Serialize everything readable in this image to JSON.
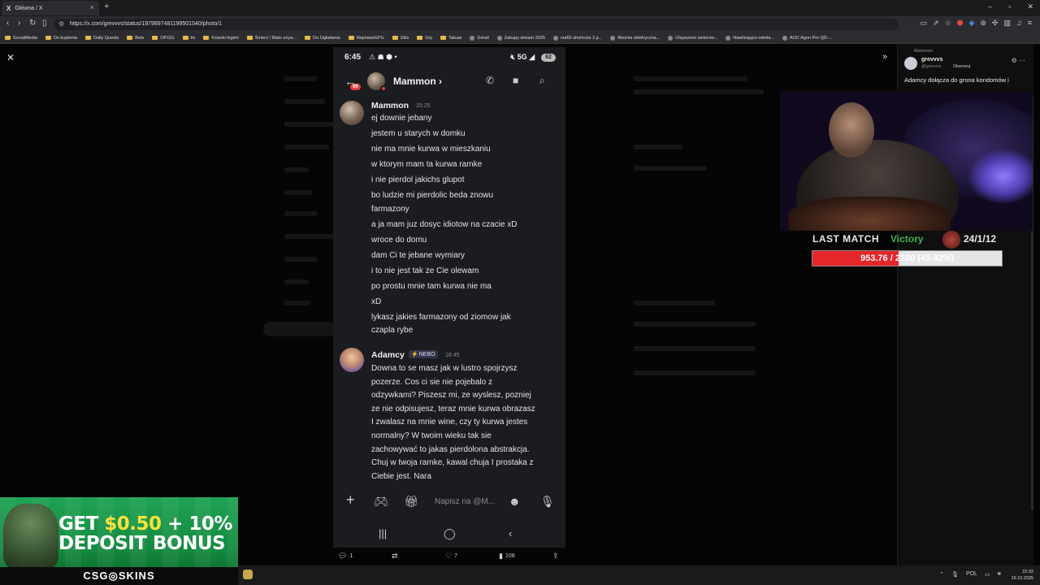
{
  "browser": {
    "tab_title": "Główna / X",
    "tab_icon": "x-logo-icon",
    "url": "https://x.com/grevvvs/status/1979897481199501540/photo/1",
    "bookmarks": [
      "SocialMedia",
      "Do kupienia",
      "Daily Quests",
      "Bets",
      "OP.GG",
      "ttv",
      "Ksiazki legimi",
      "Śmieci / Mało używ...",
      "Do Ogladania",
      "NaprawaGPU",
      "Utils",
      "Gry",
      "Tatuaż",
      "Gmail",
      "Zakupy stream 2025",
      "nut65 shortcuts 2.p...",
      "Bieżnia elektryczna...",
      "Ulepszone welurow...",
      "Nawilżająco-odmła...",
      "AOC Agon Pro QD-..."
    ]
  },
  "phone": {
    "status_time": "6:45",
    "network": "5G",
    "battery": "62",
    "dm_name": "Mammon",
    "unread_badge": "99",
    "messages": [
      {
        "author": "Mammon",
        "time": "15:25",
        "lines": [
          "ej downie jebany",
          "jestem u starych w domku",
          "nie ma mnie kurwa w mieszkaniu",
          "w ktorym mam ta kurwa ramke",
          "i nie pierdol jakichs glupot",
          "bo ludzie mi pierdolic beda znowu",
          "farmazony",
          "a ja mam juz dosyc idiotow na czacie xD",
          "wroce do domu",
          "dam Ci te jebane wymiary",
          "i to nie jest tak ze Cie olewam",
          "po prostu mnie tam kurwa nie ma",
          "xD",
          "lykasz jakies farmazony od ziomow jak",
          "czapla rybe"
        ]
      },
      {
        "author": "Adamcy",
        "badge": "NEBO",
        "time": "18:45",
        "lines": [
          "Downa to se masz jak w lustro spojrzysz",
          "pozerze. Cos ci sie nie pojebalo z",
          "odzywkami? Piszesz mi, ze wyslesz, pozniej",
          "ze nie odpisujesz, teraz mnie kurwa obrazasz",
          "I zwalasz na mnie wine, czy ty kurwa jestes",
          "normalny? W twoim wieku tak sie",
          "zachowywać to jakas pierdolona abstrakcja.",
          "Chuj w twoja ramke, kawal chuja I prostaka z",
          "Ciebie jest. Nara"
        ]
      }
    ],
    "input_placeholder": "Napisz na @M..."
  },
  "tweet_actions": {
    "replies": "1",
    "reposts": "",
    "likes": "7",
    "views": "108"
  },
  "reply_panel": {
    "replying_to": "Mammon",
    "name": "grevvvs",
    "handle": "@grevvvs",
    "follow_label": "Obserwuj",
    "text": "Adamcy dołącza do grona kondomów i"
  },
  "overlay": {
    "last_match_label": "LAST MATCH",
    "result": "Victory",
    "kda": "24/1/12",
    "progress_text": "953.76 / 2100 (45.42%)",
    "progress_fraction": 0.4542
  },
  "promo": {
    "line1_prefix": "GET ",
    "line1_amount": "$0.50",
    "line1_suffix": " + 10%",
    "line2": "DEPOSIT BONUS",
    "brand": "CSG◎SKINS"
  },
  "taskbar": {
    "lang": "POL",
    "time": "22:32",
    "date": "19.10.2025"
  },
  "colors": {
    "victory": "#3fb04a",
    "progress_fill": "#e5262a",
    "promo_green": "#1fa254",
    "discord_bg": "#1b1c20"
  }
}
